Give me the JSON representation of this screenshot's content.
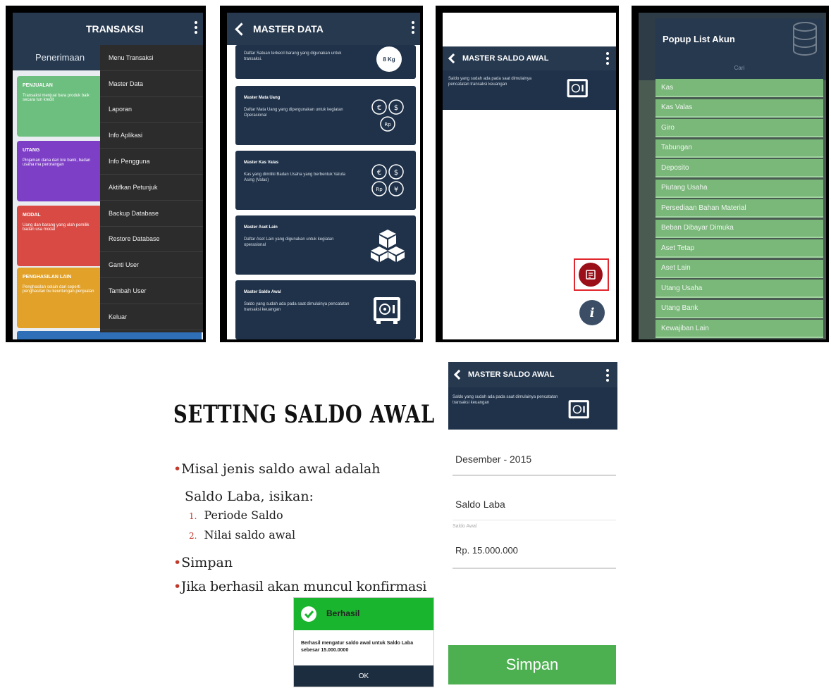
{
  "screen1": {
    "title": "TRANSAKSI",
    "tab": "Penerimaan",
    "cards": [
      {
        "title": "PENJUALAN",
        "desc": "Transaksi menjual bara produk baik secara tun kredit",
        "color": "#6cbf7e"
      },
      {
        "title": "UTANG",
        "desc": "Pinjaman dana dari kre bank, badan usaha ma perorangan",
        "color": "#7d3fc6"
      },
      {
        "title": "MODAL",
        "desc": "Uang dan barang yang ulah pemilik badan usa modal",
        "color": "#d94a44"
      },
      {
        "title": "PENGHASILAN LAIN",
        "desc": "Penghasilan selain dari seperti penghasilan bu keuntungan penjualan",
        "color": "#e2a22a"
      }
    ],
    "menu": [
      "Menu Transaksi",
      "Master Data",
      "Laporan",
      "Info Aplikasi",
      "Info Pengguna",
      "Aktifkan Petunjuk",
      "Backup Database",
      "Restore Database",
      "Ganti User",
      "Tambah User",
      "Keluar"
    ]
  },
  "screen2": {
    "title": "MASTER DATA",
    "top_desc": "Daftar Satuan terkecil barang yang digunakan untuk transaksi.",
    "top_badge": "8 Kg",
    "cards": [
      {
        "title": "Master Mata Uang",
        "desc": "Daftar Mata Uang yang dipergunakan untuk kegiatan Operasional"
      },
      {
        "title": "Master Kas Valas",
        "desc": "Kas yang dimiliki Badan Usaha yang berbentuk Valuta Asing (Valas)"
      },
      {
        "title": "Master Aset Lain",
        "desc": "Daftar Aset Lain yang digunakan untuk kegiatan operasional"
      },
      {
        "title": "Master Saldo Awal",
        "desc": "Saldo yang sudah ada pada saat dimulainya pencatatan transaksi keuangan"
      }
    ]
  },
  "screen3": {
    "title": "MASTER SALDO AWAL",
    "desc": "Saldo yang sudah ada pada saat dimulainya pencatatan transaksi keuangan",
    "info_glyph": "i"
  },
  "screen4": {
    "title": "Popup List Akun",
    "search_placeholder": "Cari",
    "accounts": [
      "Kas",
      "Kas Valas",
      "Giro",
      "Tabungan",
      "Deposito",
      "Piutang Usaha",
      "Persediaan Bahan Material",
      "Beban Dibayar Dimuka",
      "Aset Tetap",
      "Aset Lain",
      "Utang Usaha",
      "Utang Bank",
      "Kewajiban Lain"
    ]
  },
  "slide": {
    "heading": "SETTING SALDO AWAL",
    "bullet1": "Misal jenis saldo awal adalah",
    "bullet1b": "Saldo Laba, isikan:",
    "items": [
      "Periode Saldo",
      "Nilai saldo awal"
    ],
    "bullet2": "Simpan",
    "bullet3": "Jika berhasil akan muncul konfirmasi"
  },
  "dialog": {
    "title": "Berhasil",
    "message": "Berhasil mengatur saldo awal untuk Saldo Laba sebesar 15.000.0000",
    "ok": "OK"
  },
  "screen5": {
    "title": "MASTER SALDO AWAL",
    "desc": "Saldo yang sudah ada pada saat dimulainya pencatatan transaksi keuangan",
    "periode": "Desember - 2015",
    "akun": "Saldo Laba",
    "saldo_label": "Saldo Awal",
    "saldo_value": "Rp. 15.000.000",
    "save": "Simpan"
  }
}
